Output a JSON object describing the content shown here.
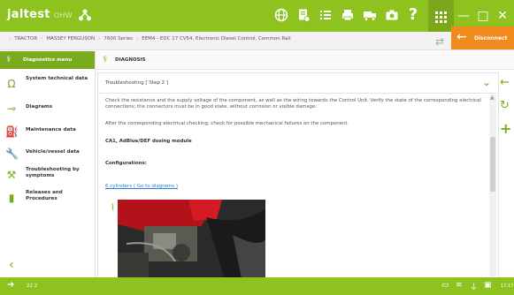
{
  "header": {
    "logo": "jaltest",
    "logo_sub": "OHW",
    "icons": [
      "link-icon",
      "globe-icon",
      "document-icon",
      "list-icon",
      "printer-icon",
      "truck-icon",
      "camera-icon",
      "help-icon",
      "apps-icon"
    ],
    "help_label": "?"
  },
  "window": {
    "minimize": "—",
    "maximize": "□",
    "close": "✕"
  },
  "breadcrumbs": [
    "TRACTOR",
    "MASSEY FERGUSON",
    "7600 Series",
    "EEM4 - EDC 17 CV54, Electronic Diesel Control, Common Rail"
  ],
  "disconnect": {
    "label": "Disconnect"
  },
  "sidebar": {
    "header": "Diagnostics menu",
    "items": [
      {
        "label": "System technical data",
        "icon": "omega-icon"
      },
      {
        "label": "Diagrams",
        "icon": "probe-icon"
      },
      {
        "label": "Maintenance data",
        "icon": "oil-can-icon"
      },
      {
        "label": "Vehicle/vessel data",
        "icon": "wrench-icon"
      },
      {
        "label": "Troubleshooting by symptoms",
        "icon": "tools-icon"
      },
      {
        "label": "Releases and Procedures",
        "icon": "book-icon"
      }
    ]
  },
  "main": {
    "title": "DIAGNOSIS",
    "step_title": "Troubleshooting [ Step 2 ]",
    "para1": "Check the resistance and the supply voltage of the component, as well as the wiring towards the Control Unit. Verify the state of the corresponding electrical connections; the connectors must be in good state, without corrosion or visible damage.",
    "para2": "After the corresponding electrical checking, check for possible mechanical failures on the component.",
    "component": "CA1, AdBlue/DEF dosing module",
    "configurations_label": "Configurations:",
    "config_link": "6 cylinders ( Go to diagrams )"
  },
  "status": {
    "version": "22.2",
    "time": "17:17"
  },
  "colors": {
    "brand_green": "#8dc21f",
    "accent_orange": "#f08a1c",
    "link_blue": "#2a7fd0"
  }
}
